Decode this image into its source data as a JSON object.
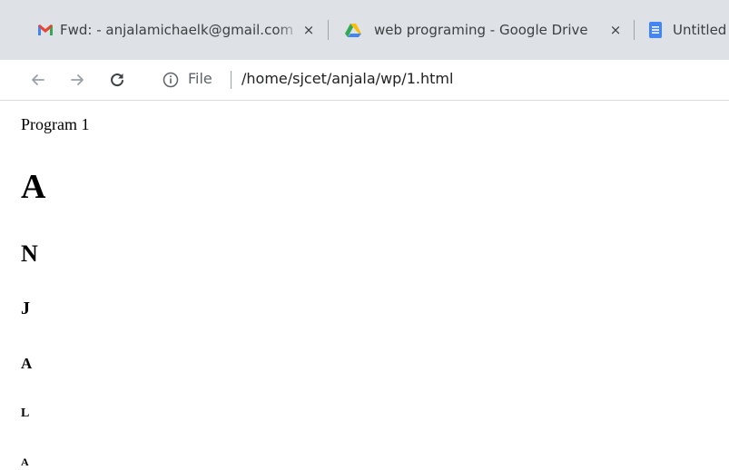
{
  "browser": {
    "tabs": [
      {
        "title": "Fwd: - anjalamichaelk@gmail.com",
        "icon": "gmail-icon",
        "close": "×"
      },
      {
        "title": "web programing - Google Drive",
        "icon": "google-drive-icon",
        "close": "×"
      },
      {
        "title": "Untitled document",
        "icon": "google-docs-icon"
      }
    ],
    "address": {
      "scheme_label": "File",
      "url": "/home/sjcet/anjala/wp/1.html"
    }
  },
  "page": {
    "paragraph": "Program 1",
    "headings": [
      "A",
      "N",
      "J",
      "A",
      "L",
      "A"
    ]
  },
  "colors": {
    "tabstrip_bg": "#dee1e6",
    "gmail_red": "#ea4335",
    "drive_green": "#34a853",
    "drive_yellow": "#fbbc04",
    "drive_blue": "#4285f4",
    "docs_blue": "#4285f4"
  }
}
